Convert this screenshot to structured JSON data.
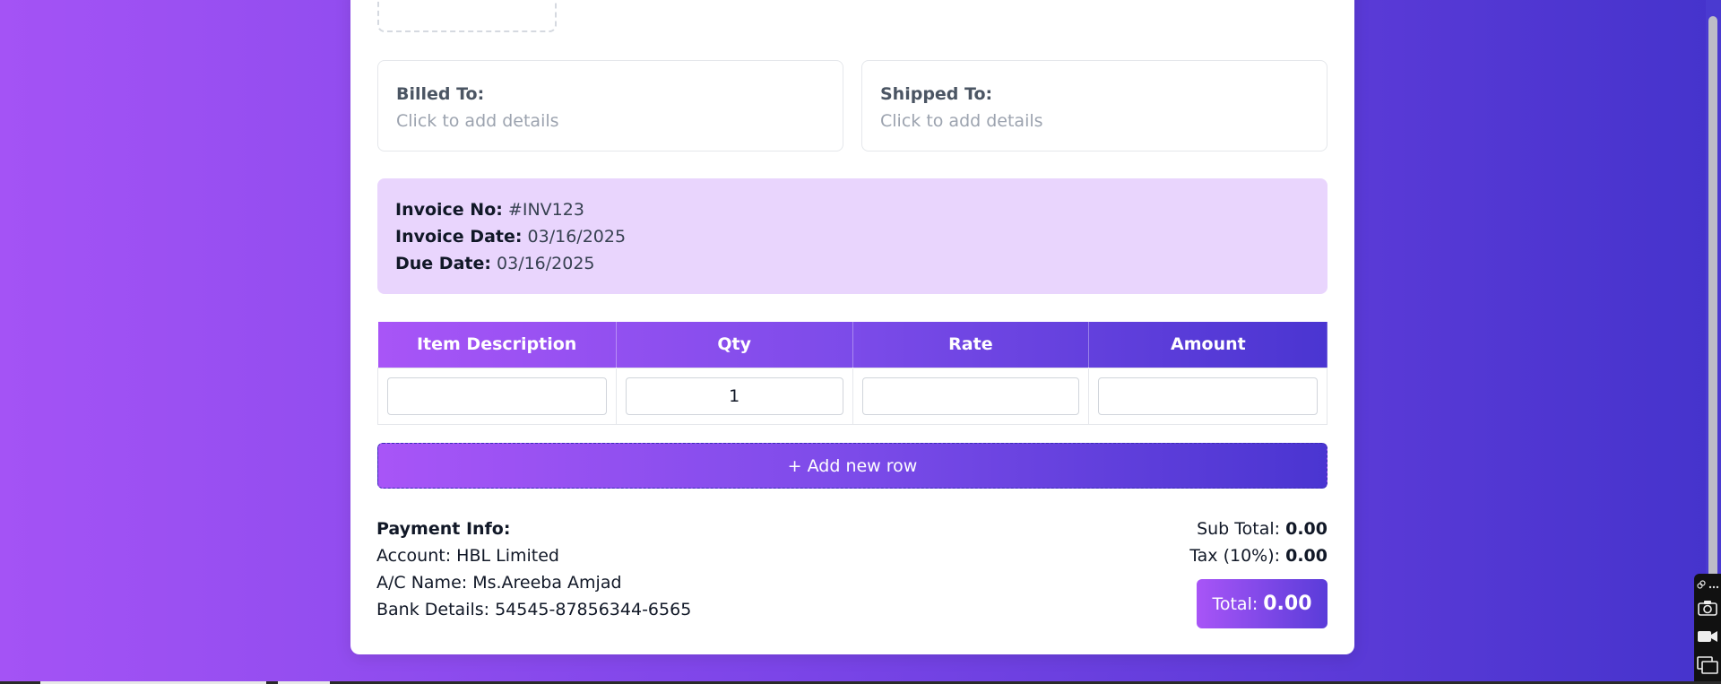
{
  "billed_to": {
    "title": "Billed To:",
    "placeholder": "Click to add details"
  },
  "shipped_to": {
    "title": "Shipped To:",
    "placeholder": "Click to add details"
  },
  "invoice_info": {
    "number_label": "Invoice No:",
    "number_value": "#INV123",
    "date_label": "Invoice Date:",
    "date_value": "03/16/2025",
    "due_label": "Due Date:",
    "due_value": "03/16/2025"
  },
  "table": {
    "headers": [
      "Item Description",
      "Qty",
      "Rate",
      "Amount"
    ],
    "rows": [
      {
        "description": "",
        "qty": "1",
        "rate": "",
        "amount": ""
      }
    ]
  },
  "add_row_label": "+ Add new row",
  "payment": {
    "title": "Payment Info:",
    "account": "Account: HBL Limited",
    "ac_name": "A/C Name: Ms.Areeba Amjad",
    "bank": "Bank Details: 54545-87856344-6565"
  },
  "totals": {
    "sub_label": "Sub Total:",
    "sub_value": "0.00",
    "tax_label": "Tax (10%):",
    "tax_value": "0.00",
    "total_label": "Total:",
    "total_value": "0.00"
  },
  "icons": [
    "link-icon",
    "more-icon",
    "camera-icon",
    "video-icon",
    "windows-icon"
  ],
  "colors": {
    "accent_start": "#a855f7",
    "accent_end": "#4a35d1",
    "info_bg": "#e9d5fd"
  }
}
